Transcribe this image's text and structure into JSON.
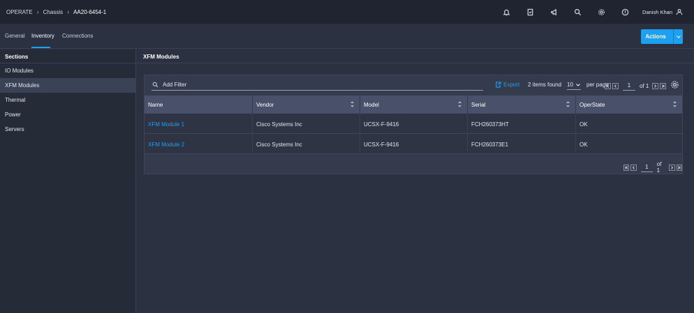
{
  "breadcrumb": {
    "items": [
      "OPERATE",
      "Chassis",
      "AA20-6454-1"
    ]
  },
  "header": {
    "user_name": "Danish Khan",
    "icons": [
      "bell-icon",
      "clipboard-icon",
      "megaphone-icon",
      "search-icon",
      "gear-icon",
      "help-icon",
      "user-icon"
    ]
  },
  "tabs": [
    {
      "label": "General",
      "active": false
    },
    {
      "label": "Inventory",
      "active": true
    },
    {
      "label": "Connections",
      "active": false
    }
  ],
  "actions": {
    "label": "Actions"
  },
  "sidebar": {
    "heading": "Sections",
    "items": [
      {
        "label": "IO Modules",
        "selected": false
      },
      {
        "label": "XFM Modules",
        "selected": true
      },
      {
        "label": "Thermal",
        "selected": false
      },
      {
        "label": "Power",
        "selected": false
      },
      {
        "label": "Servers",
        "selected": false
      }
    ]
  },
  "main": {
    "title": "XFM Modules"
  },
  "toolbar": {
    "filter_placeholder": "Add Filter",
    "export_label": "Export",
    "items_found": "2 items found",
    "per_page_value": "10",
    "per_page_label": "per page",
    "page": "1",
    "of_pages": "of 1"
  },
  "table": {
    "columns": [
      "Name",
      "Vendor",
      "Model",
      "Serial",
      "OperState"
    ],
    "rows": [
      [
        "XFM Module 1",
        "Cisco Systems Inc",
        "UCSX-F-9416",
        "FCH260373HT",
        "OK"
      ],
      [
        "XFM Module 2",
        "Cisco Systems Inc",
        "UCSX-F-9416",
        "FCH260373E1",
        "OK"
      ]
    ]
  },
  "footer_pager": {
    "page": "1",
    "of_pages": "of 1"
  },
  "colors": {
    "accent": "#1ba0f2",
    "topbar": "#1f2430",
    "background": "#2b3140"
  }
}
